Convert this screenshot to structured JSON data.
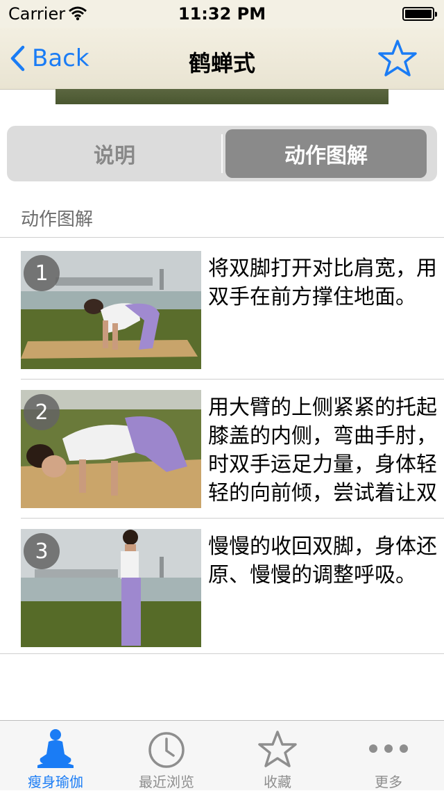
{
  "status_bar": {
    "carrier": "Carrier",
    "time": "11:32 PM"
  },
  "nav": {
    "back_label": "Back",
    "title": "鹤蝉式"
  },
  "segments": {
    "left": "说明",
    "right": "动作图解",
    "selected": "right"
  },
  "section_header": "动作图解",
  "steps": [
    {
      "number": "1",
      "text": "将双脚打开对比肩宽，用双手在前方撑住地面。"
    },
    {
      "number": "2",
      "text": "用大臂的上侧紧紧的托起膝盖的内侧，弯曲手肘，时双手运足力量，身体轻轻的向前倾，尝试着让双脚离开地面。"
    },
    {
      "number": "3",
      "text": "慢慢的收回双脚，身体还原、慢慢的调整呼吸。"
    }
  ],
  "tabbar": [
    {
      "label": "瘦身瑜伽",
      "icon": "meditation-icon",
      "active": true
    },
    {
      "label": "最近浏览",
      "icon": "clock-icon",
      "active": false
    },
    {
      "label": "收藏",
      "icon": "star-icon",
      "active": false
    },
    {
      "label": "更多",
      "icon": "more-icon",
      "active": false
    }
  ],
  "colors": {
    "accent": "#1a7cf5",
    "segment_selected": "#8a8a8a",
    "nav_bg": "#efebdc"
  }
}
